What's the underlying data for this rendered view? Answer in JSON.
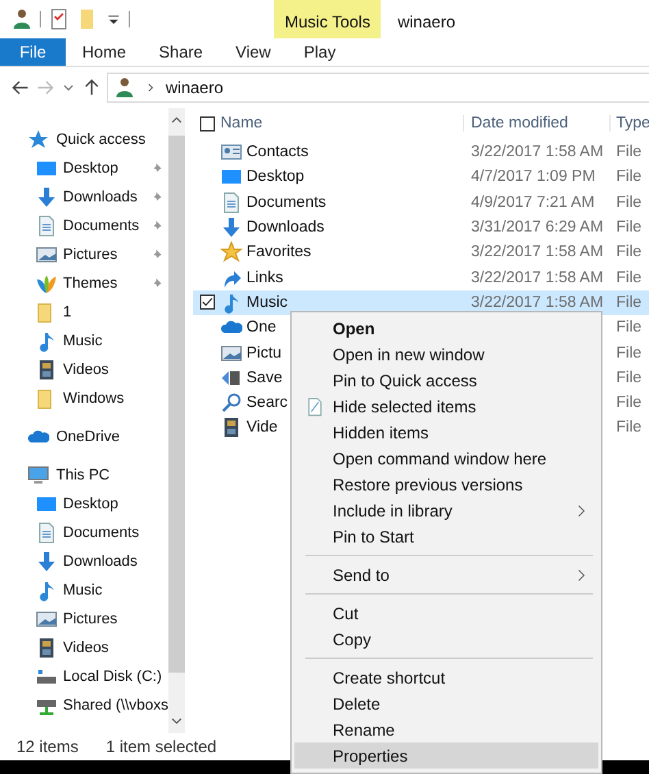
{
  "window": {
    "title": "winaero",
    "context_tab": "Music Tools"
  },
  "ribbon_tabs": [
    {
      "label": "File",
      "kind": "file",
      "selected": false
    },
    {
      "label": "Home",
      "kind": "tab",
      "selected": false
    },
    {
      "label": "Share",
      "kind": "tab",
      "selected": false
    },
    {
      "label": "View",
      "kind": "tab",
      "selected": false
    },
    {
      "label": "Play",
      "kind": "tab",
      "selected": false
    }
  ],
  "address": {
    "path": [
      "winaero"
    ]
  },
  "sidebar": {
    "items": [
      {
        "label": "Quick access",
        "children": [
          {
            "label": "Desktop",
            "pinned": true
          },
          {
            "label": "Downloads",
            "pinned": true
          },
          {
            "label": "Documents",
            "pinned": true
          },
          {
            "label": "Pictures",
            "pinned": true
          },
          {
            "label": "Themes",
            "pinned": true
          },
          {
            "label": "1",
            "pinned": false
          },
          {
            "label": "Music",
            "pinned": false
          },
          {
            "label": "Videos",
            "pinned": false
          },
          {
            "label": "Windows",
            "pinned": false
          }
        ]
      },
      {
        "label": "OneDrive"
      },
      {
        "label": "This PC",
        "children": [
          {
            "label": "Desktop"
          },
          {
            "label": "Documents"
          },
          {
            "label": "Downloads"
          },
          {
            "label": "Music"
          },
          {
            "label": "Pictures"
          },
          {
            "label": "Videos"
          },
          {
            "label": "Local Disk (C:)"
          },
          {
            "label": "Shared (\\\\vboxs"
          }
        ]
      }
    ]
  },
  "table": {
    "columns": [
      "Name",
      "Date modified",
      "Type"
    ],
    "select_all": {
      "checked": false
    },
    "rows": [
      {
        "name": "Contacts",
        "date": "3/22/2017 1:58 AM",
        "type": "File",
        "selected": false,
        "checked": false
      },
      {
        "name": "Desktop",
        "date": "4/7/2017 1:09 PM",
        "type": "File",
        "selected": false,
        "checked": false
      },
      {
        "name": "Documents",
        "date": "4/9/2017 7:21 AM",
        "type": "File",
        "selected": false,
        "checked": false
      },
      {
        "name": "Downloads",
        "date": "3/31/2017 6:29 AM",
        "type": "File",
        "selected": false,
        "checked": false
      },
      {
        "name": "Favorites",
        "date": "3/22/2017 1:58 AM",
        "type": "File",
        "selected": false,
        "checked": false
      },
      {
        "name": "Links",
        "date": "3/22/2017 1:58 AM",
        "type": "File",
        "selected": false,
        "checked": false
      },
      {
        "name": "Music",
        "date": "3/22/2017 1:58 AM",
        "type": "File",
        "selected": true,
        "checked": true
      },
      {
        "name": "One",
        "type": "File",
        "selected": false,
        "checked": false
      },
      {
        "name": "Pictu",
        "type": "File",
        "selected": false,
        "checked": false
      },
      {
        "name": "Save",
        "type": "File",
        "selected": false,
        "checked": false
      },
      {
        "name": "Searc",
        "type": "File",
        "selected": false,
        "checked": false
      },
      {
        "name": "Vide",
        "type": "File",
        "selected": false,
        "checked": false
      }
    ]
  },
  "context_menu": {
    "items": [
      {
        "kind": "item",
        "label": "Open",
        "bold": true,
        "submenu": false,
        "selected": false
      },
      {
        "kind": "item",
        "label": "Open in new window",
        "bold": false,
        "submenu": false,
        "selected": false
      },
      {
        "kind": "item",
        "label": "Pin to Quick access",
        "bold": false,
        "submenu": false,
        "selected": false
      },
      {
        "kind": "item",
        "label": "Hide selected items",
        "bold": false,
        "submenu": false,
        "selected": false
      },
      {
        "kind": "item",
        "label": "Hidden items",
        "bold": false,
        "submenu": false,
        "selected": false
      },
      {
        "kind": "item",
        "label": "Open command window here",
        "bold": false,
        "submenu": false,
        "selected": false
      },
      {
        "kind": "item",
        "label": "Restore previous versions",
        "bold": false,
        "submenu": false,
        "selected": false
      },
      {
        "kind": "item",
        "label": "Include in library",
        "bold": false,
        "submenu": true,
        "selected": false
      },
      {
        "kind": "item",
        "label": "Pin to Start",
        "bold": false,
        "submenu": false,
        "selected": false
      },
      {
        "kind": "separator"
      },
      {
        "kind": "item",
        "label": "Send to",
        "bold": false,
        "submenu": true,
        "selected": false
      },
      {
        "kind": "separator"
      },
      {
        "kind": "item",
        "label": "Cut",
        "bold": false,
        "submenu": false,
        "selected": false
      },
      {
        "kind": "item",
        "label": "Copy",
        "bold": false,
        "submenu": false,
        "selected": false
      },
      {
        "kind": "separator"
      },
      {
        "kind": "item",
        "label": "Create shortcut",
        "bold": false,
        "submenu": false,
        "selected": false
      },
      {
        "kind": "item",
        "label": "Delete",
        "bold": false,
        "submenu": false,
        "selected": false
      },
      {
        "kind": "item",
        "label": "Rename",
        "bold": false,
        "submenu": false,
        "selected": false
      },
      {
        "kind": "item",
        "label": "Properties",
        "bold": false,
        "submenu": false,
        "selected": true
      }
    ]
  },
  "status_bar": {
    "items": [
      "12 items",
      "1 item selected"
    ]
  }
}
